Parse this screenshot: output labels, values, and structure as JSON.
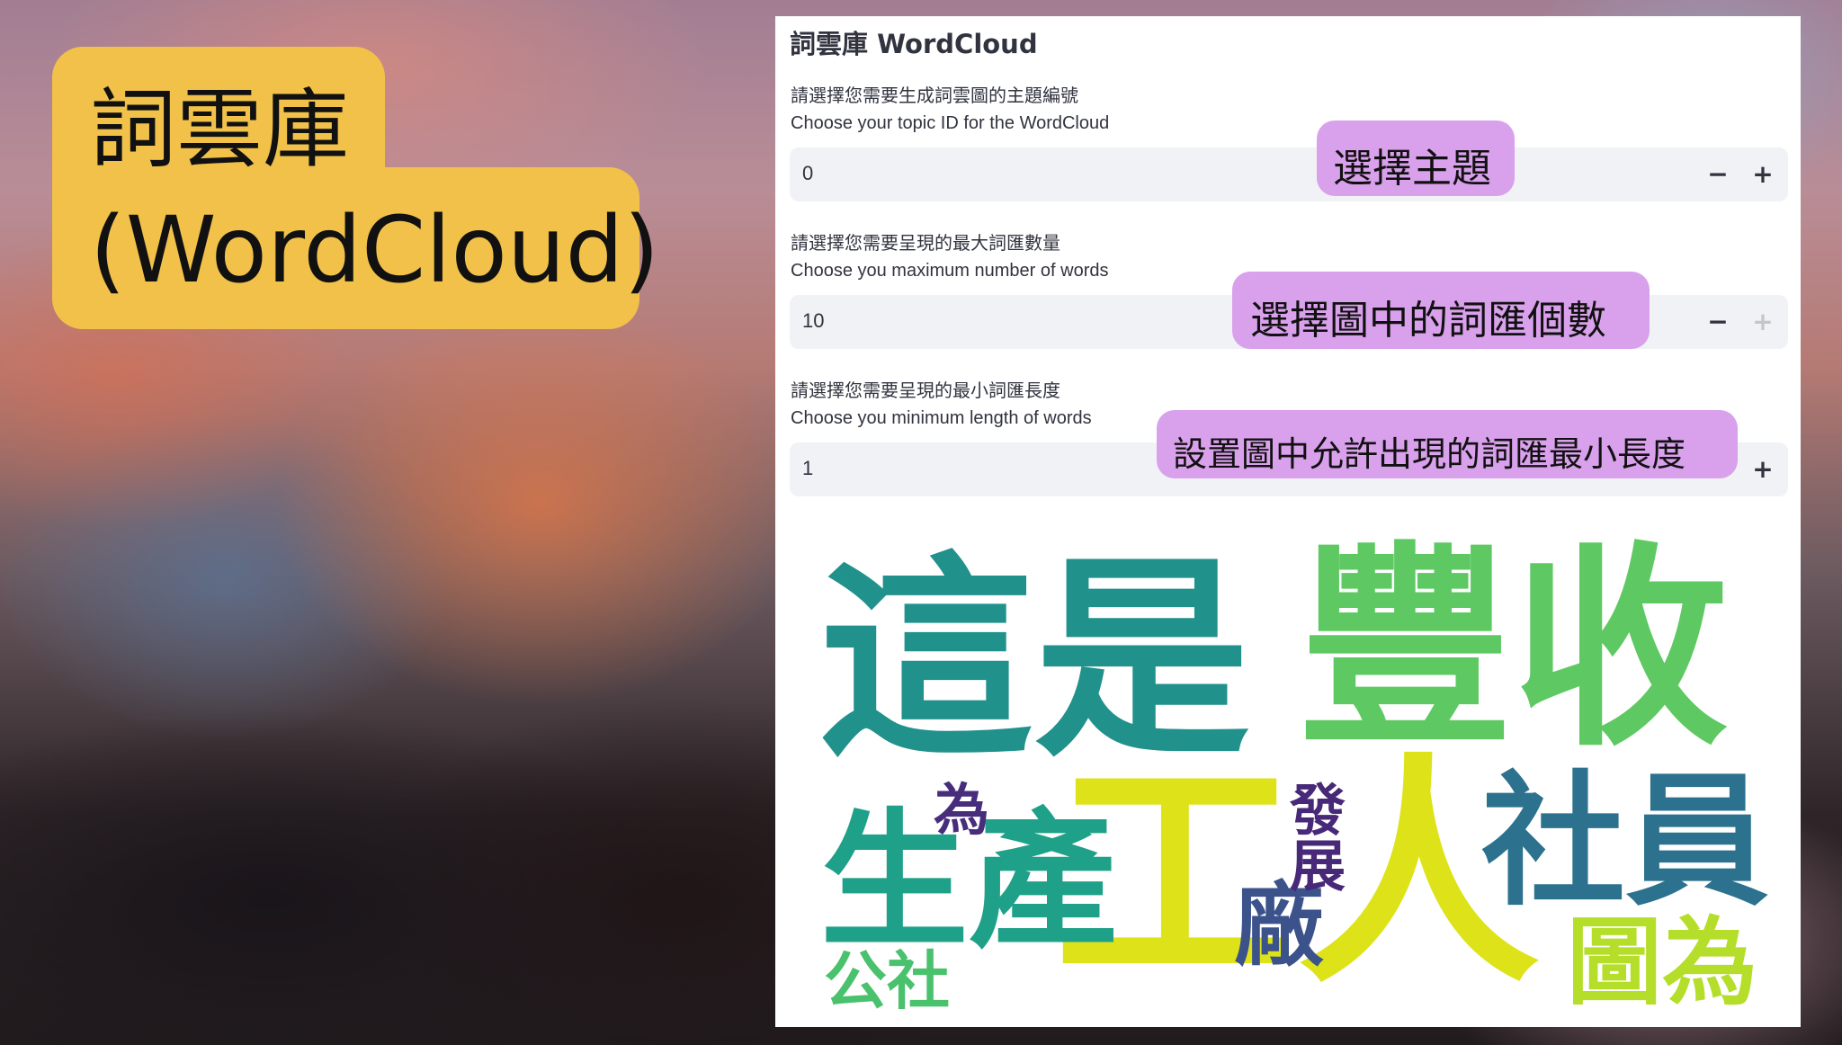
{
  "title_badge": {
    "line1": "詞雲庫",
    "line2": "(WordCloud)"
  },
  "panel": {
    "title": "詞雲庫 WordCloud",
    "fields": [
      {
        "label_zh": "請選擇您需要生成詞雲圖的主題編號",
        "label_en": "Choose your topic ID for the WordCloud",
        "value": "0",
        "minus": "−",
        "plus": "+",
        "plus_enabled": true,
        "minus_enabled": true
      },
      {
        "label_zh": "請選擇您需要呈現的最大詞匯數量",
        "label_en": "Choose you maximum number of words",
        "value": "10",
        "minus": "−",
        "plus": "+",
        "plus_enabled": false,
        "minus_enabled": true
      },
      {
        "label_zh": "請選擇您需要呈現的最小詞匯長度",
        "label_en": "Choose you minimum length of words",
        "value": "1",
        "plus": "+",
        "plus_enabled": true
      }
    ]
  },
  "callouts": {
    "topic": "選擇主題",
    "max_words": "選擇圖中的詞匯個數",
    "min_length": "設置圖中允許出現的詞匯最小長度"
  },
  "wordcloud": {
    "words": [
      {
        "text": "這是",
        "color": "#21918c"
      },
      {
        "text": "豐收",
        "color": "#5ec962"
      },
      {
        "text": "工人",
        "color": "#dde318"
      },
      {
        "text": "社員",
        "color": "#2c728e"
      },
      {
        "text": "生產",
        "color": "#1fa088"
      },
      {
        "text": "廠",
        "color": "#3b528b"
      },
      {
        "text": "發展",
        "color": "#482878"
      },
      {
        "text": "為",
        "color": "#472d7b"
      },
      {
        "text": "圖為",
        "color": "#b5de2b"
      },
      {
        "text": "公社",
        "color": "#4ac16d"
      }
    ]
  }
}
